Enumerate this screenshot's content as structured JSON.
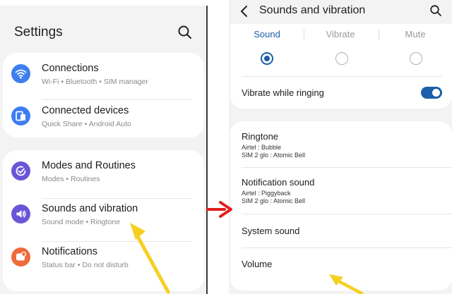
{
  "left": {
    "title": "Settings",
    "items": [
      {
        "title": "Connections",
        "subtitle": "Wi-Fi  •  Bluetooth  •  SIM manager",
        "icon": "wifi-icon",
        "color": "#3d7ef0"
      },
      {
        "title": "Connected devices",
        "subtitle": "Quick Share  •  Android Auto",
        "icon": "devices-icon",
        "color": "#3d7ef0"
      },
      {
        "title": "Modes and Routines",
        "subtitle": "Modes  •  Routines",
        "icon": "check-circle-icon",
        "color": "#6a55d8"
      },
      {
        "title": "Sounds and vibration",
        "subtitle": "Sound mode  •  Ringtone",
        "icon": "speaker-icon",
        "color": "#6a55d8"
      },
      {
        "title": "Notifications",
        "subtitle": "Status bar  •  Do not disturb",
        "icon": "notification-icon",
        "color": "#f06a3a"
      }
    ]
  },
  "right": {
    "title": "Sounds and vibration",
    "sound_modes": [
      {
        "label": "Sound",
        "selected": true
      },
      {
        "label": "Vibrate",
        "selected": false
      },
      {
        "label": "Mute",
        "selected": false
      }
    ],
    "vibrate_while_ringing": "Vibrate while ringing",
    "ringtone": {
      "title": "Ringtone",
      "line1": "Airtel : Bubble",
      "line2": "SIM 2 glo : Atomic Bell"
    },
    "notification_sound": {
      "title": "Notification sound",
      "line1": "Airtel : Piggyback",
      "line2": "SIM 2 glo : Atomic Bell"
    },
    "system_sound": "System sound",
    "volume": "Volume"
  },
  "colors": {
    "accent": "#1a5fa8",
    "arrow_yellow": "#f5d020",
    "arrow_red": "#e11d1d"
  }
}
